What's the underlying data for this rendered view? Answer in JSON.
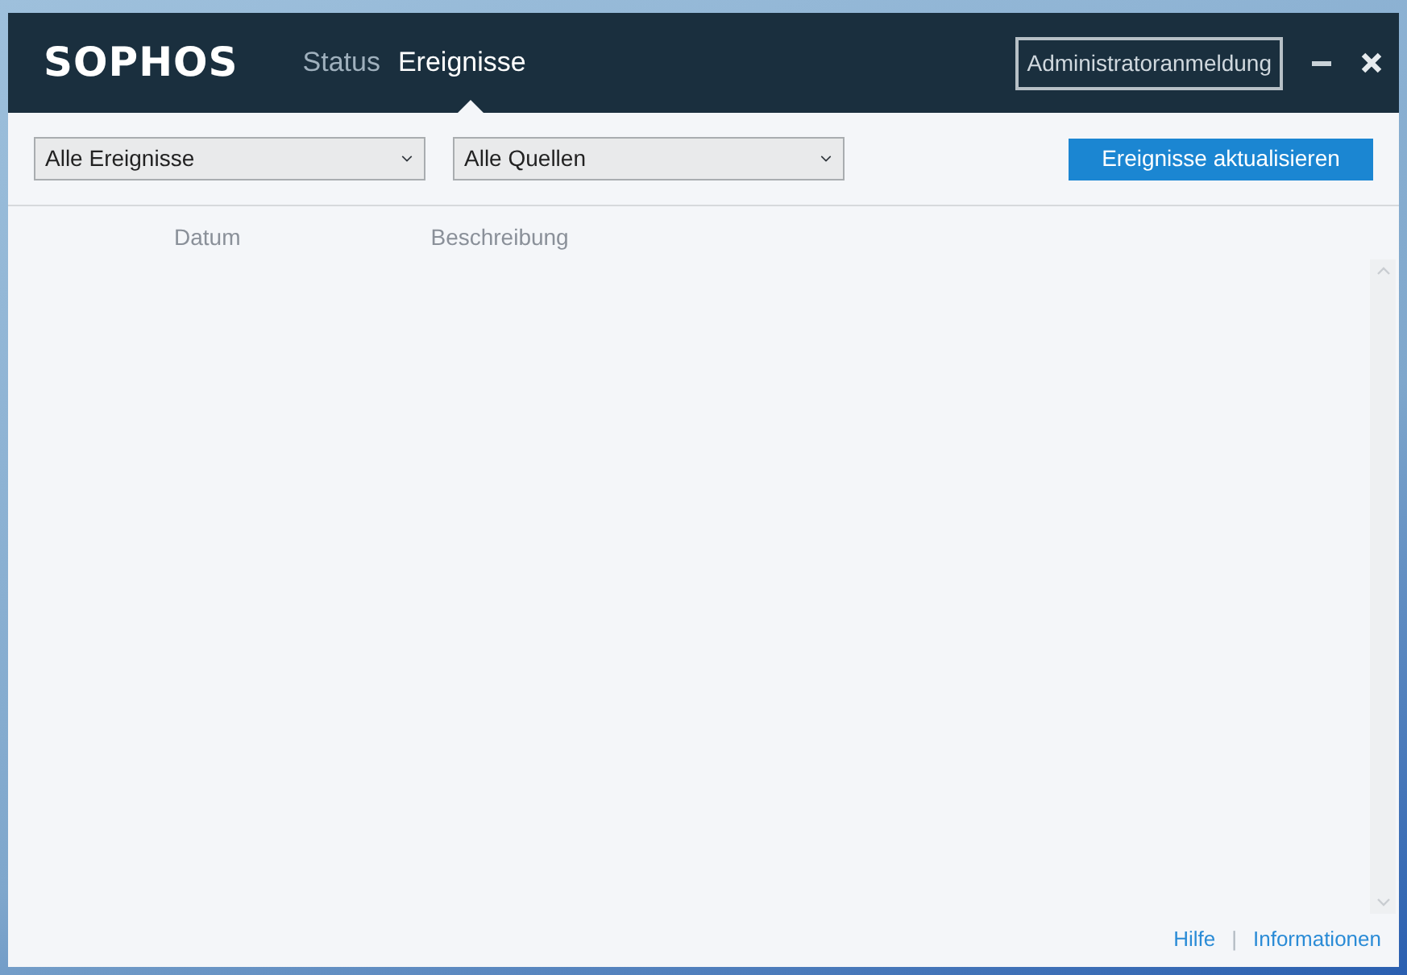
{
  "header": {
    "logo": "SOPHOS",
    "admin_button": "Administratoranmeldung"
  },
  "tabs": [
    {
      "label": "Status",
      "selected": false
    },
    {
      "label": "Ereignisse",
      "selected": true
    }
  ],
  "filters": [
    {
      "value": "Alle Ereignisse"
    },
    {
      "value": "Alle Quellen"
    }
  ],
  "refresh_button": "Ereignisse aktualisieren",
  "table": {
    "columns": [
      "Datum",
      "Beschreibung"
    ]
  },
  "footer": {
    "links": [
      "Hilfe",
      "Informationen"
    ],
    "separator": "|"
  }
}
